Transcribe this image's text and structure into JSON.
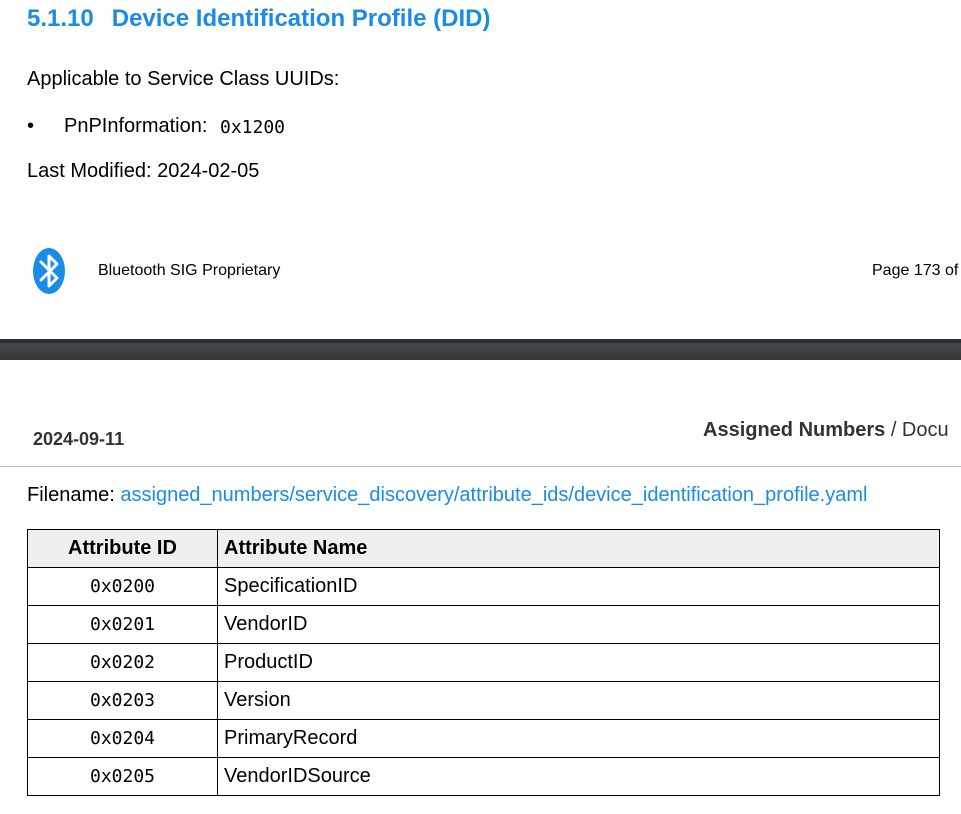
{
  "page1": {
    "section_number": "5.1.10",
    "section_title": "Device Identification Profile (DID)",
    "applicable_label": "Applicable to Service Class UUIDs:",
    "bullet_char": "•",
    "uuid_name": "PnPInformation:",
    "uuid_value": "0x1200",
    "last_modified": "Last Modified: 2024-02-05",
    "footer_left": "Bluetooth SIG Proprietary",
    "footer_right": "Page 173 of",
    "logo_icon": "bluetooth-icon"
  },
  "page2": {
    "header_date": "2024-09-11",
    "header_doc_bold": "Assigned Numbers",
    "header_doc_rest": " / Docu",
    "filename_label": "Filename:",
    "filename_link": "assigned_numbers/service_discovery/attribute_ids/device_identification_profile.yaml",
    "table": {
      "headers": [
        "Attribute ID",
        "Attribute Name"
      ],
      "rows": [
        [
          "0x0200",
          "SpecificationID"
        ],
        [
          "0x0201",
          "VendorID"
        ],
        [
          "0x0202",
          "ProductID"
        ],
        [
          "0x0203",
          "Version"
        ],
        [
          "0x0204",
          "PrimaryRecord"
        ],
        [
          "0x0205",
          "VendorIDSource"
        ]
      ]
    }
  },
  "colors": {
    "heading_blue": "#1a8be6",
    "separator_gray": "#3f4245",
    "table_header_bg": "#efefef"
  }
}
